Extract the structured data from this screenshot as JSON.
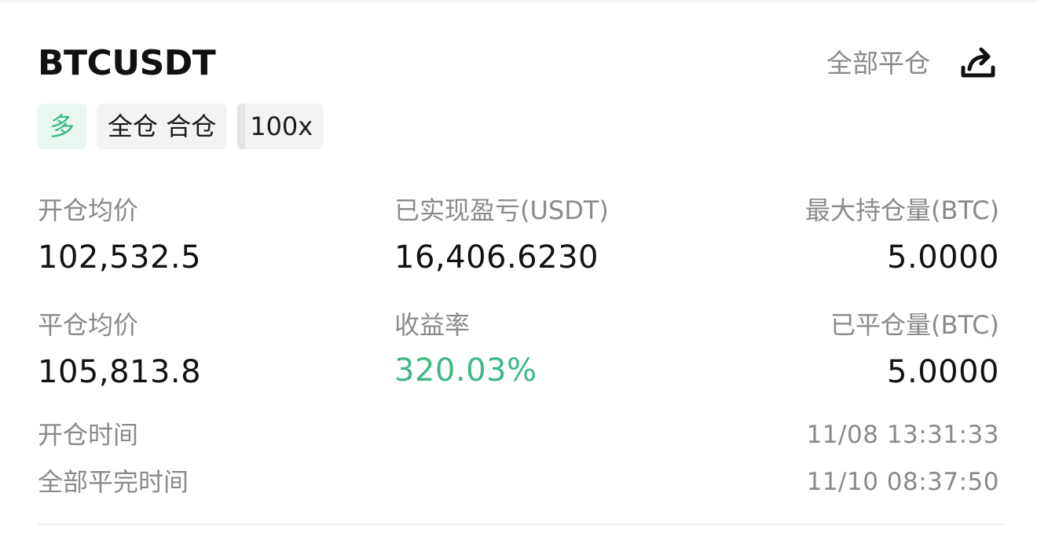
{
  "position": {
    "symbol": "BTCUSDT",
    "close_all_label": "全部平仓",
    "tags": {
      "side": "多",
      "margin_mode": "全仓 合仓",
      "leverage": "100x"
    }
  },
  "stats": {
    "avg_open_price": {
      "label": "开仓均价",
      "value": "102,532.5"
    },
    "realized_pnl": {
      "label": "已实现盈亏(USDT)",
      "value": "16,406.6230"
    },
    "max_position": {
      "label": "最大持仓量(BTC)",
      "value": "5.0000"
    },
    "avg_close_price": {
      "label": "平仓均价",
      "value": "105,813.8"
    },
    "roi": {
      "label": "收益率",
      "value": "320.03%"
    },
    "closed_amount": {
      "label": "已平仓量(BTC)",
      "value": "5.0000"
    }
  },
  "times": {
    "open_time": {
      "label": "开仓时间",
      "value": "11/08 13:31:33"
    },
    "full_close_time": {
      "label": "全部平完时间",
      "value": "11/10 08:37:50"
    }
  },
  "colors": {
    "profit_green": "#3fb884",
    "long_tag_bg": "#e9f7f0",
    "muted_text": "#8a8a8a"
  },
  "icons": {
    "share": "share-icon"
  }
}
